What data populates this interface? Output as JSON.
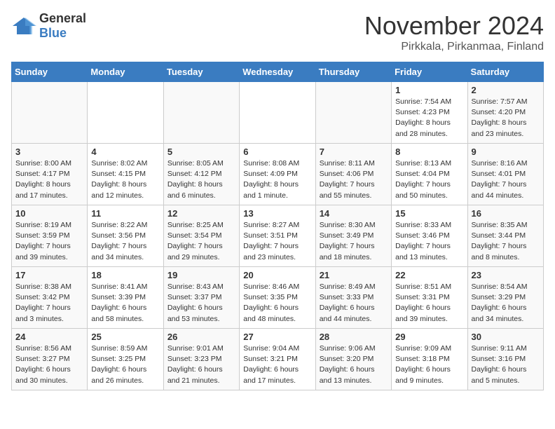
{
  "logo": {
    "general": "General",
    "blue": "Blue"
  },
  "header": {
    "month": "November 2024",
    "location": "Pirkkala, Pirkanmaa, Finland"
  },
  "weekdays": [
    "Sunday",
    "Monday",
    "Tuesday",
    "Wednesday",
    "Thursday",
    "Friday",
    "Saturday"
  ],
  "weeks": [
    [
      {
        "day": "",
        "info": ""
      },
      {
        "day": "",
        "info": ""
      },
      {
        "day": "",
        "info": ""
      },
      {
        "day": "",
        "info": ""
      },
      {
        "day": "",
        "info": ""
      },
      {
        "day": "1",
        "info": "Sunrise: 7:54 AM\nSunset: 4:23 PM\nDaylight: 8 hours and 28 minutes."
      },
      {
        "day": "2",
        "info": "Sunrise: 7:57 AM\nSunset: 4:20 PM\nDaylight: 8 hours and 23 minutes."
      }
    ],
    [
      {
        "day": "3",
        "info": "Sunrise: 8:00 AM\nSunset: 4:17 PM\nDaylight: 8 hours and 17 minutes."
      },
      {
        "day": "4",
        "info": "Sunrise: 8:02 AM\nSunset: 4:15 PM\nDaylight: 8 hours and 12 minutes."
      },
      {
        "day": "5",
        "info": "Sunrise: 8:05 AM\nSunset: 4:12 PM\nDaylight: 8 hours and 6 minutes."
      },
      {
        "day": "6",
        "info": "Sunrise: 8:08 AM\nSunset: 4:09 PM\nDaylight: 8 hours and 1 minute."
      },
      {
        "day": "7",
        "info": "Sunrise: 8:11 AM\nSunset: 4:06 PM\nDaylight: 7 hours and 55 minutes."
      },
      {
        "day": "8",
        "info": "Sunrise: 8:13 AM\nSunset: 4:04 PM\nDaylight: 7 hours and 50 minutes."
      },
      {
        "day": "9",
        "info": "Sunrise: 8:16 AM\nSunset: 4:01 PM\nDaylight: 7 hours and 44 minutes."
      }
    ],
    [
      {
        "day": "10",
        "info": "Sunrise: 8:19 AM\nSunset: 3:59 PM\nDaylight: 7 hours and 39 minutes."
      },
      {
        "day": "11",
        "info": "Sunrise: 8:22 AM\nSunset: 3:56 PM\nDaylight: 7 hours and 34 minutes."
      },
      {
        "day": "12",
        "info": "Sunrise: 8:25 AM\nSunset: 3:54 PM\nDaylight: 7 hours and 29 minutes."
      },
      {
        "day": "13",
        "info": "Sunrise: 8:27 AM\nSunset: 3:51 PM\nDaylight: 7 hours and 23 minutes."
      },
      {
        "day": "14",
        "info": "Sunrise: 8:30 AM\nSunset: 3:49 PM\nDaylight: 7 hours and 18 minutes."
      },
      {
        "day": "15",
        "info": "Sunrise: 8:33 AM\nSunset: 3:46 PM\nDaylight: 7 hours and 13 minutes."
      },
      {
        "day": "16",
        "info": "Sunrise: 8:35 AM\nSunset: 3:44 PM\nDaylight: 7 hours and 8 minutes."
      }
    ],
    [
      {
        "day": "17",
        "info": "Sunrise: 8:38 AM\nSunset: 3:42 PM\nDaylight: 7 hours and 3 minutes."
      },
      {
        "day": "18",
        "info": "Sunrise: 8:41 AM\nSunset: 3:39 PM\nDaylight: 6 hours and 58 minutes."
      },
      {
        "day": "19",
        "info": "Sunrise: 8:43 AM\nSunset: 3:37 PM\nDaylight: 6 hours and 53 minutes."
      },
      {
        "day": "20",
        "info": "Sunrise: 8:46 AM\nSunset: 3:35 PM\nDaylight: 6 hours and 48 minutes."
      },
      {
        "day": "21",
        "info": "Sunrise: 8:49 AM\nSunset: 3:33 PM\nDaylight: 6 hours and 44 minutes."
      },
      {
        "day": "22",
        "info": "Sunrise: 8:51 AM\nSunset: 3:31 PM\nDaylight: 6 hours and 39 minutes."
      },
      {
        "day": "23",
        "info": "Sunrise: 8:54 AM\nSunset: 3:29 PM\nDaylight: 6 hours and 34 minutes."
      }
    ],
    [
      {
        "day": "24",
        "info": "Sunrise: 8:56 AM\nSunset: 3:27 PM\nDaylight: 6 hours and 30 minutes."
      },
      {
        "day": "25",
        "info": "Sunrise: 8:59 AM\nSunset: 3:25 PM\nDaylight: 6 hours and 26 minutes."
      },
      {
        "day": "26",
        "info": "Sunrise: 9:01 AM\nSunset: 3:23 PM\nDaylight: 6 hours and 21 minutes."
      },
      {
        "day": "27",
        "info": "Sunrise: 9:04 AM\nSunset: 3:21 PM\nDaylight: 6 hours and 17 minutes."
      },
      {
        "day": "28",
        "info": "Sunrise: 9:06 AM\nSunset: 3:20 PM\nDaylight: 6 hours and 13 minutes."
      },
      {
        "day": "29",
        "info": "Sunrise: 9:09 AM\nSunset: 3:18 PM\nDaylight: 6 hours and 9 minutes."
      },
      {
        "day": "30",
        "info": "Sunrise: 9:11 AM\nSunset: 3:16 PM\nDaylight: 6 hours and 5 minutes."
      }
    ]
  ]
}
